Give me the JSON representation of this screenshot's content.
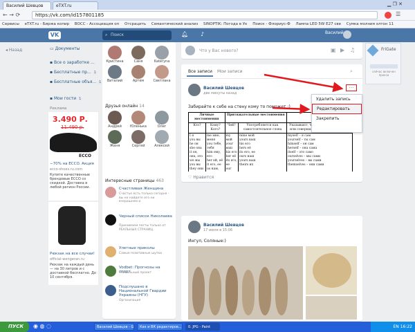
{
  "browser": {
    "tabs": [
      {
        "label": "Василий Шевцов"
      },
      {
        "label": "eTXT.ru"
      }
    ],
    "url": "https://vk.com/id157801185",
    "bookmarks": [
      "Сервисы",
      "eTXT.ru - Биржа копир",
      "ВОСС - Ассоциация оп",
      "Отсрацить",
      "Семантический анализ",
      "SINOPTIK: Погода в Ук",
      "Поиск - Флориус-Ф",
      "Лампа LED 5W E27 све",
      "Сумка молния элтон 11"
    ]
  },
  "vk": {
    "search_placeholder": "Поиск",
    "user_name": "Василий",
    "back_label": "Назад",
    "left_nav": [
      {
        "label": "Документы"
      },
      {
        "label": "Все о заработке ..."
      },
      {
        "label": "Бесплатные пр...",
        "count": "1"
      },
      {
        "label": "Бесплатные объя...",
        "count": "1"
      },
      {
        "label": "Мои гости",
        "count": "1"
      }
    ],
    "ad_header": "Реклама",
    "ad1": {
      "price": "3.490 Р.",
      "old_price": "11.490 р.",
      "brand": "ECCO",
      "discount": "−70% на ECCO. Акция",
      "domain": "ecco-shoes.ru.com",
      "text": "Купите качественные брендовые ECCO со скидкой. Доставка в любой регион России."
    },
    "ad2": {
      "title": "Рюкзак на все случаи!",
      "domain": "official-wengeran.ru",
      "text": "Рюкзак на каждый день — на 30 литров и с доставкой бесплатно. До 10 сентября."
    },
    "friends": [
      {
        "name": "Кристина"
      },
      {
        "name": "Саня"
      },
      {
        "name": "Kateryna"
      },
      {
        "name": "Виталий"
      },
      {
        "name": "Артем"
      },
      {
        "name": "Светлана"
      }
    ],
    "friends_online_label": "Друзья онлайн",
    "friends_online_count": "14",
    "online": [
      {
        "name": "Андрей"
      },
      {
        "name": "Юленька"
      },
      {
        "name": "Олег"
      },
      {
        "name": "Женя"
      },
      {
        "name": "Сергей"
      },
      {
        "name": "Алексей"
      }
    ],
    "pages_label": "Интересные страницы",
    "pages_count": "463",
    "pages": [
      {
        "title": "Счастливая Женщина",
        "desc": "Счастье есть только сегодня - вы не найдете его ни вчерашнем и"
      },
      {
        "title": "Черный список Николаева",
        "desc": "Принимаем посты только от РЕАЛЬНЫХ СТРАНИЦ."
      },
      {
        "title": "Улетные приколы",
        "desc": "Самые позитивные шутки"
      },
      {
        "title": "Vodbet: Прогнозы на спорт",
        "desc": "Уникальный проект"
      },
      {
        "title": "Подслушано в Национальной Гвардии Украины (НГУ)",
        "desc": "Организация"
      }
    ],
    "composer_placeholder": "Что у Вас нового?",
    "feed_tabs": [
      "Все записи",
      "Мои записи"
    ],
    "post1": {
      "author": "Василий Шевцов",
      "time": "две минуты назад",
      "text": "Забирайте к себе на стену кому то поможет :)",
      "like": "Нравится",
      "more": "…"
    },
    "menu": [
      "Удалить запись",
      "Редактировать",
      "Закрепить"
    ],
    "table": {
      "headers": [
        "Личные местоимения",
        "Притяжательные местоимения",
        "Возв"
      ],
      "subheaders": [
        "Кто?",
        "Кому? Кого?",
        "Чей?",
        "Употребляется как самостоятельное слова",
        "Указывают, что действие совершено или совершается самим говорящим"
      ],
      "rows": [
        [
          "I я\nyou вы\nhe он\nshe она\nit он, она, это\nwe мы\nyou вы\nthey они",
          "me мне, меня\nyou тебе, тебя\nhim ему, его\nher ей, её\nit его, ее\nus нам, нас\nyou вам, вас\nthem их, им",
          "my мой\nyour ваш\nhis его\nher её\nits его, ее\nour наш\nyour ваш\ntheir их",
          "mine мой\nyours ваш\nhis его\nhers её\nits его, ее\nours наш\nyours ваш\ntheirs их",
          "myself – я сам\nyourself – ты сам\nhimself – он сам\nherself – она сама\nitself – это само\nourselves – мы сами\nyourselves – вы сами\nthemselves – они сами"
        ]
      ]
    },
    "post2": {
      "author": "Василий Шевцов",
      "time": "17 июля в 15:06",
      "text": "Ингул, Соляные:)"
    },
    "right_widget": {
      "title": "FriGate",
      "note": "сейчас включен прокси"
    }
  },
  "taskbar": {
    "start": "ПУСК",
    "items": [
      "Василий Шевцов - G...",
      "Как и ВК редактиров...",
      "0. JPG - Paint"
    ],
    "lang": "EN",
    "time": "16:22"
  }
}
